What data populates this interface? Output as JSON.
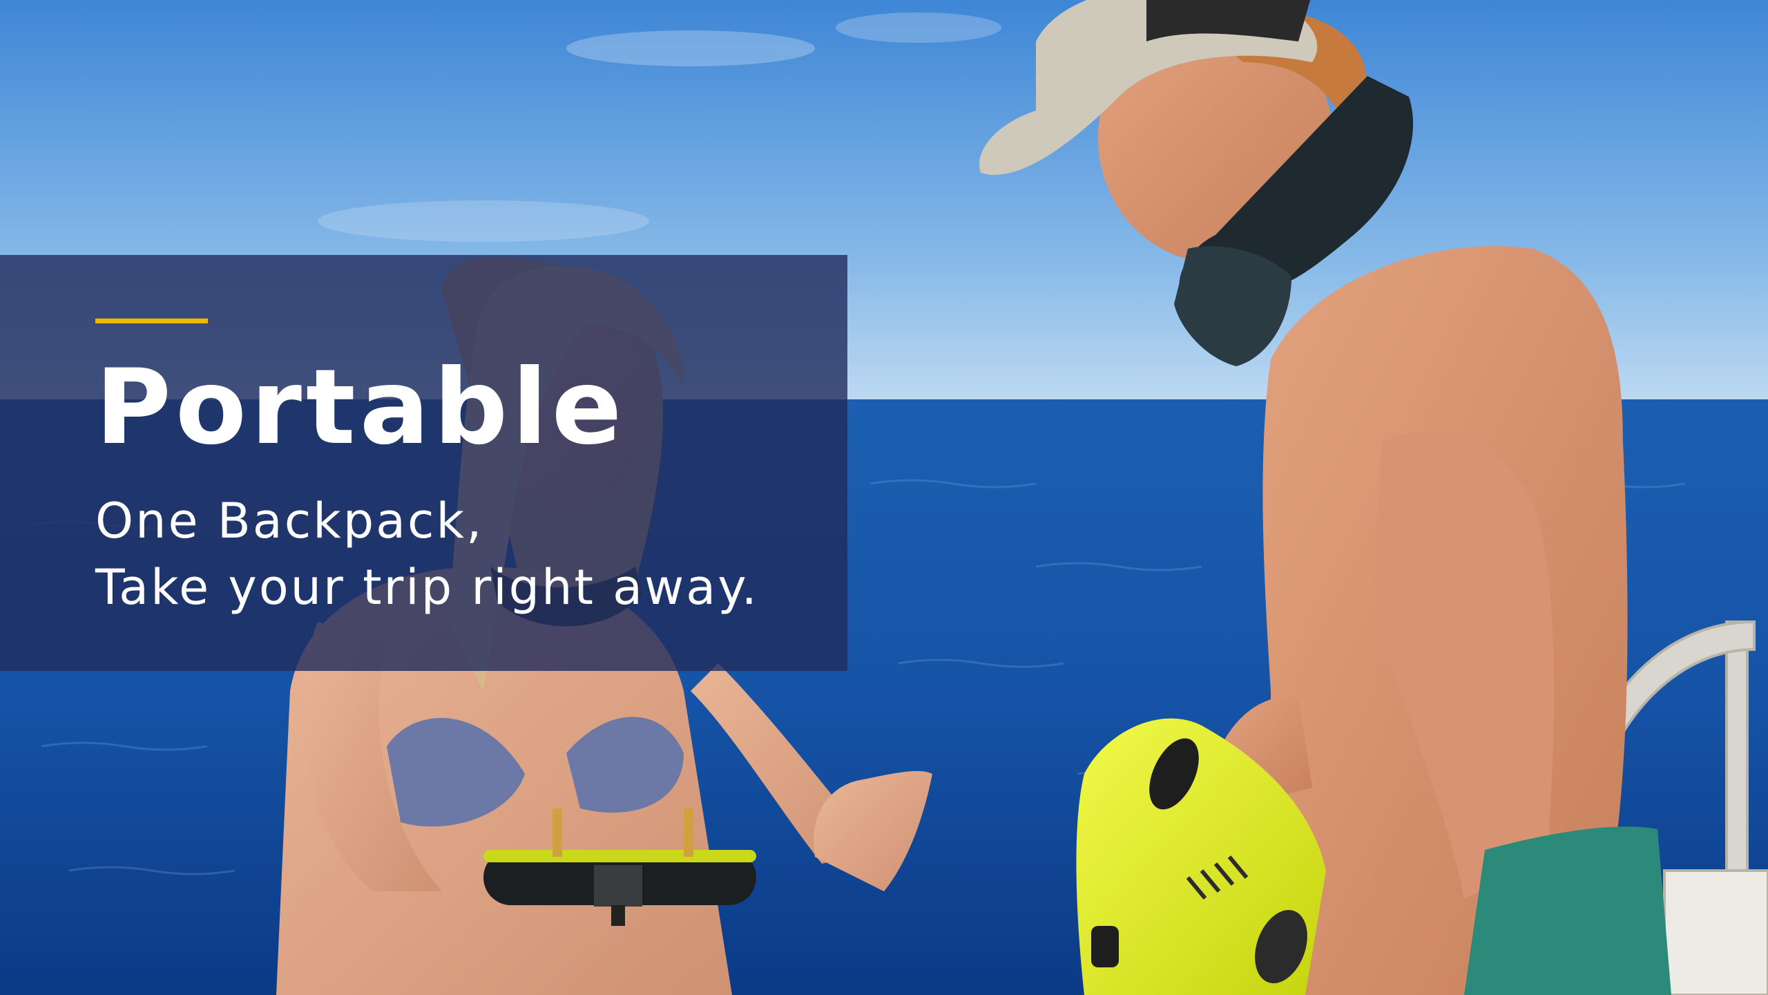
{
  "banner": {
    "headline": "Portable",
    "tagline_line1": "One Backpack,",
    "tagline_line2": "Take your trip right away."
  },
  "colors": {
    "accent_line": "#F2B705",
    "panel": "#212C5C",
    "text": "#FFFFFF",
    "sky_top": "#3E86D6",
    "sky_bottom": "#BDD9F2",
    "sea_top": "#1B5FB0",
    "sea_bottom": "#0B3A86",
    "drone": "#E4F21E"
  },
  "scene_icons": [
    "photo-background",
    "underwater-drone",
    "remote-controller"
  ]
}
